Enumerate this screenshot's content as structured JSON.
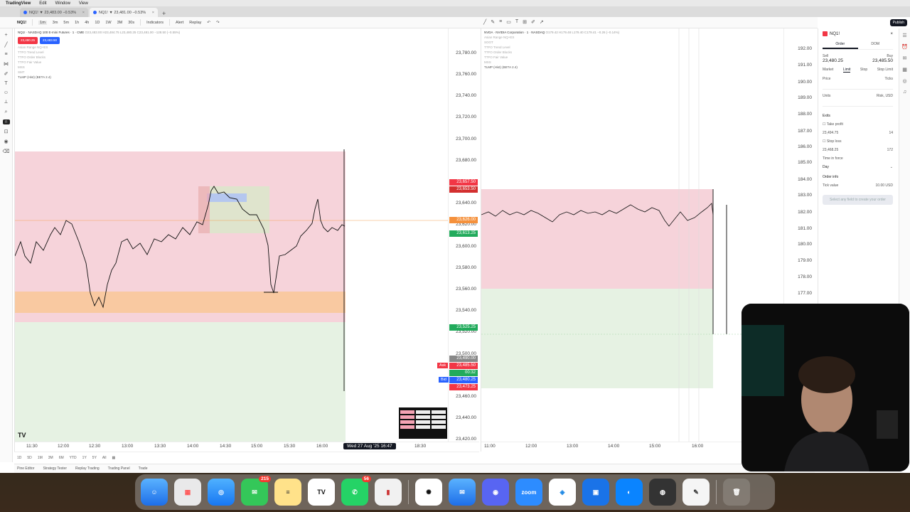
{
  "menubar": {
    "items": [
      "TradingView",
      "Edit",
      "Window",
      "View"
    ]
  },
  "browser": {
    "tabs": [
      {
        "label": "NQ1! ▼ 23,483.00 −0.53%"
      },
      {
        "label": "NQ1! ▼ 23,481.00 −0.53%"
      }
    ],
    "newtab": "+"
  },
  "toolbar": {
    "symbol": "NQ1!",
    "timeframes": [
      "1m",
      "3m",
      "5m",
      "1h",
      "4h",
      "1D",
      "1W",
      "3M",
      "30s"
    ],
    "indicators": "Indicators",
    "alert": "Alert",
    "replay": "Replay"
  },
  "chart_a": {
    "legend_title": "NQ1! · NASDAQ 100 E-mini Futures · 1 · CME",
    "ohlc": "O23,483.00 H23,484.75 L23,480.25 C23,481.00 −128.50 (−0.55%)",
    "sell_label": "23,480.25",
    "buy_label": "23,483.50",
    "indicators": [
      "Asian Range NQ+ES",
      "TTFO Trend Level",
      "TTFO Order Blocks",
      "TTFO Fair Value",
      "MSS",
      "SMT"
    ],
    "extra": "TLMP (Hist) (BETA 2.4)",
    "y_labels": [
      "23,780.00",
      "23,760.00",
      "23,740.00",
      "23,720.00",
      "23,700.00",
      "23,680.00",
      "23,640.00",
      "23,620.00",
      "23,600.00",
      "23,580.00",
      "23,560.00",
      "23,540.00",
      "23,520.00",
      "23,500.00",
      "23,460.00",
      "23,440.00",
      "23,420.00"
    ],
    "tags": {
      "t1": "23,657.50",
      "t2": "23,653.50",
      "t3": "23,626.00",
      "t4": "23,613.25",
      "t5": "23,525.25",
      "t6": "23,490.00",
      "t7": "23,485.50",
      "t8": "00:32",
      "t9": "23,480.25",
      "t10": "23,473.25"
    },
    "ask": "Ask",
    "bid": "Bid",
    "x_labels": [
      "11:30",
      "12:00",
      "12:30",
      "13:00",
      "13:30",
      "14:00",
      "14:30",
      "15:00",
      "15:30",
      "16:00",
      "18:30"
    ],
    "cursor_time": "Wed 27 Aug '25  16:47"
  },
  "chart_b": {
    "legend_title": "NVDA · NVIDIA Corporation · 1 · NASDAQ",
    "ohlc": "O179.42 H179.48 L179.40 C179.41 −0.26 (−0.14%)",
    "indicators": [
      "Asian Range NQ+ES",
      "SOOT",
      "TTFO Trend Level",
      "TTFO Order Blocks",
      "TTFO Fair Value",
      "MSS",
      "TLMP (Hist) (BETA 2.4)"
    ],
    "y_labels": [
      "192.00",
      "191.00",
      "190.00",
      "189.00",
      "188.00",
      "187.00",
      "186.00",
      "185.00",
      "184.00",
      "183.00",
      "182.00",
      "181.00",
      "180.00",
      "179.00",
      "178.00",
      "177.00"
    ],
    "x_labels": [
      "11:00",
      "12:00",
      "13:00",
      "14:00",
      "15:00",
      "16:00"
    ]
  },
  "bottom": {
    "ranges": [
      "1D",
      "5D",
      "1M",
      "3M",
      "6M",
      "YTD",
      "1Y",
      "5Y",
      "All"
    ],
    "panel_tabs": [
      "Pine Editor",
      "Strategy Tester",
      "Replay Trading",
      "Trading Panel",
      "Trade"
    ]
  },
  "order_panel": {
    "symbol": "NQ1!",
    "tabs": [
      "Order",
      "DOM"
    ],
    "sell": "Sell",
    "buy": "Buy",
    "sell_price": "23,480.25",
    "buy_price": "23,485.50",
    "types": [
      "Market",
      "Limit",
      "Stop",
      "Stop Limit"
    ],
    "price_label": "Price",
    "ticks_label": "Ticks",
    "units_label": "Units",
    "risk_label": "Risk, USD",
    "exits": "Exits",
    "take_profit": "Take profit",
    "stop_loss": "Stop loss",
    "tp_price": "23,494.75",
    "tp_ticks": "14",
    "sl_price": "23,468.25",
    "sl_ticks": "172",
    "tif_label": "Time in force",
    "tif_value": "Day",
    "order_info": "Order info",
    "tick_value": "Tick value",
    "tick_value_amt": "10.00 USD",
    "submit": "Select any field to create your order",
    "publish": "Publish"
  },
  "dock": {
    "messages_badge": "215",
    "whatsapp_badge": "56",
    "zoom_label": "zoom"
  }
}
